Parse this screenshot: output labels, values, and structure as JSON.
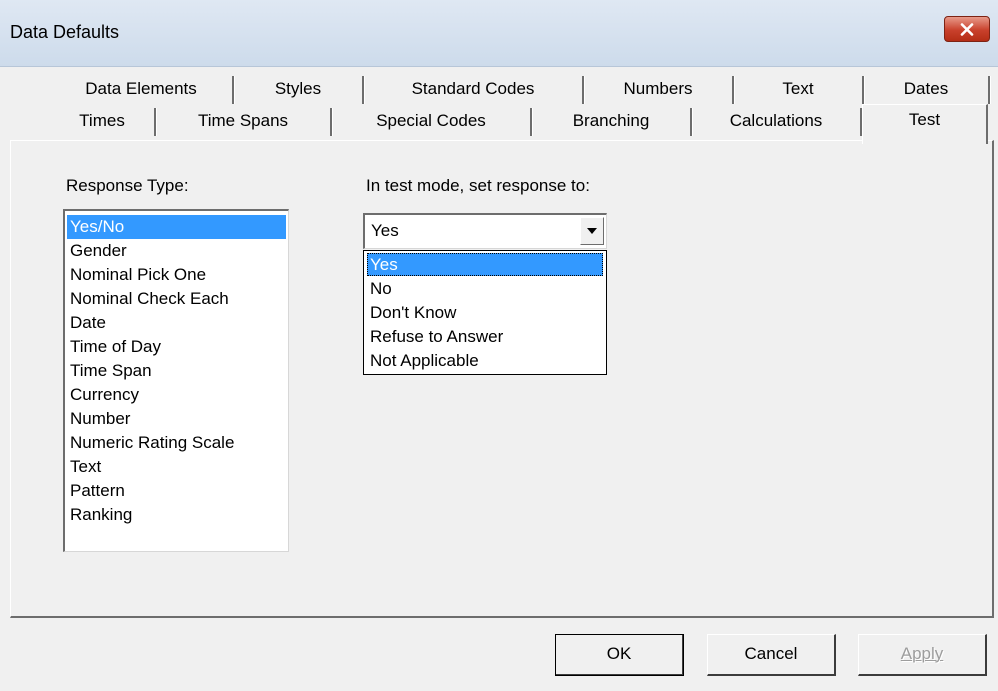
{
  "window": {
    "title": "Data Defaults",
    "close_icon": "close-icon"
  },
  "tabs": {
    "row1": [
      "Data Elements",
      "Styles",
      "Standard Codes",
      "Numbers",
      "Text",
      "Dates"
    ],
    "row2": [
      "Times",
      "Time Spans",
      "Special Codes",
      "Branching",
      "Calculations",
      "Test"
    ],
    "active": "Test"
  },
  "response_type": {
    "label": "Response Type:",
    "items": [
      "Yes/No",
      "Gender",
      "Nominal Pick One",
      "Nominal Check Each",
      "Date",
      "Time of Day",
      "Time Span",
      "Currency",
      "Number",
      "Numeric Rating Scale",
      "Text",
      "Pattern",
      "Ranking"
    ],
    "selected": "Yes/No"
  },
  "test_mode": {
    "label": "In test mode, set response to:",
    "value": "Yes",
    "options": [
      "Yes",
      "No",
      "Don't Know",
      "Refuse to Answer",
      "Not Applicable"
    ],
    "highlighted": "Yes"
  },
  "buttons": {
    "ok": "OK",
    "cancel": "Cancel",
    "apply": "Apply"
  },
  "colors": {
    "selection": "#3399ff",
    "close_button": "#c9412c",
    "dialog_bg": "#f0f0f0"
  }
}
